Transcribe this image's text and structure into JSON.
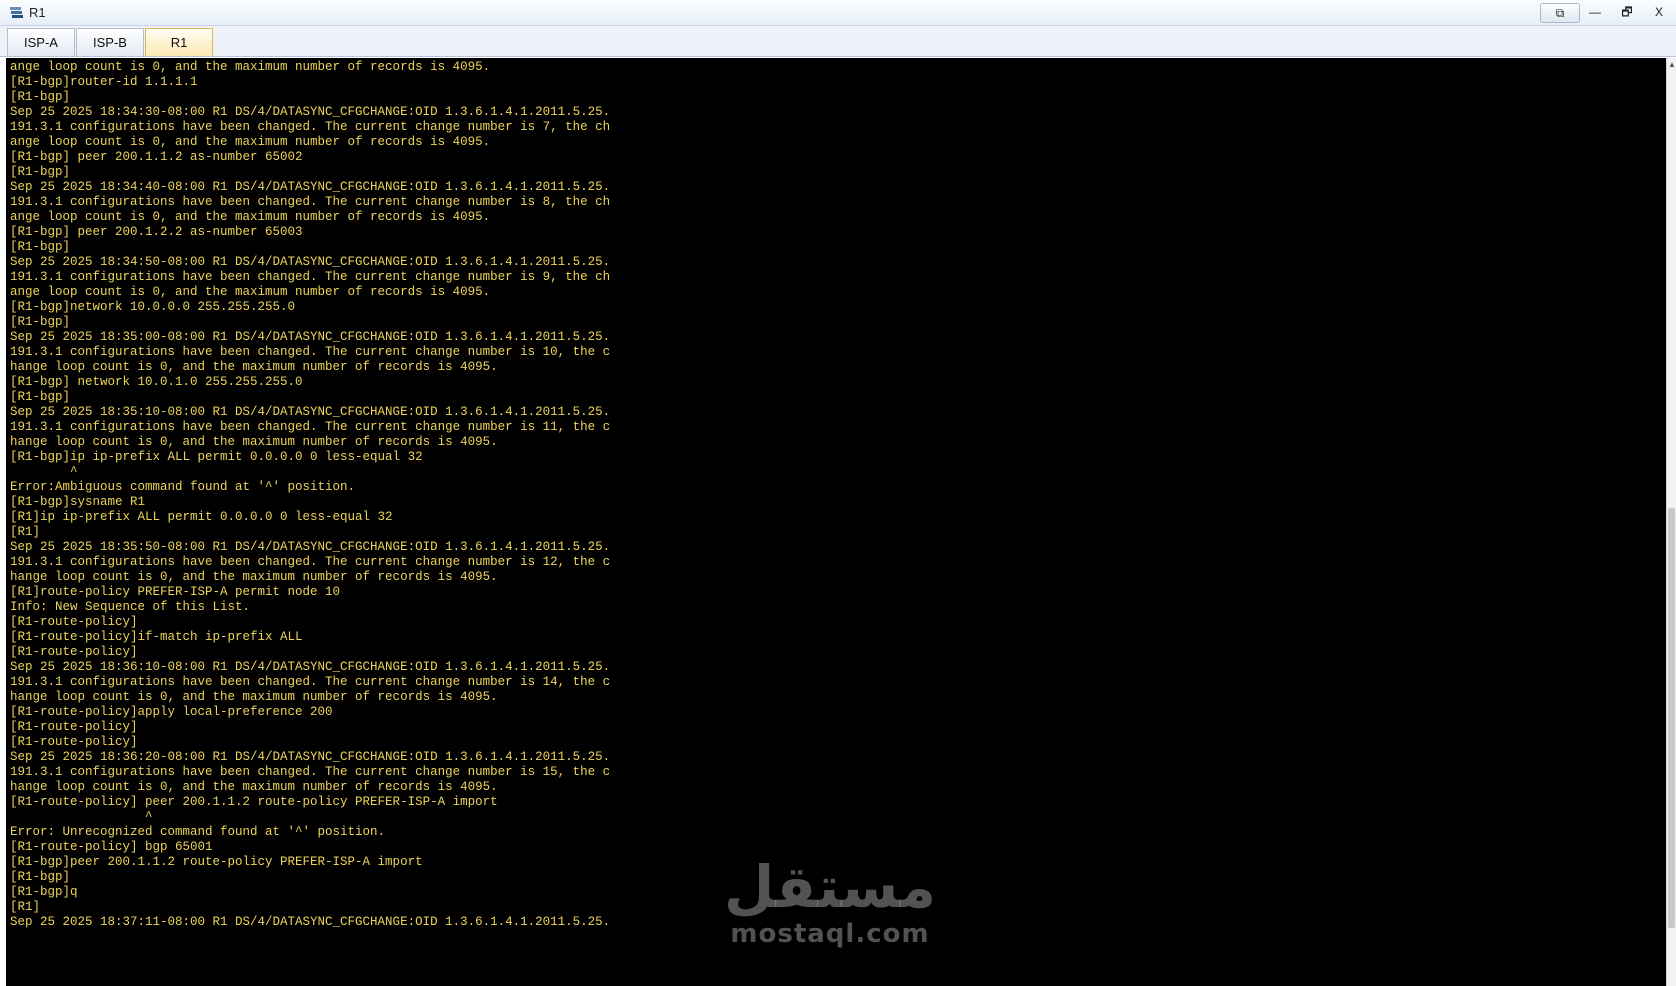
{
  "window": {
    "title": "R1",
    "buttons": {
      "restore_app": "⧉",
      "minimize": "—",
      "maximize": "🗗",
      "close": "X"
    }
  },
  "tabs": [
    {
      "label": "ISP-A",
      "active": false
    },
    {
      "label": "ISP-B",
      "active": false
    },
    {
      "label": "R1",
      "active": true
    }
  ],
  "terminal": {
    "text_color": "#ecd45a",
    "background": "#000000",
    "lines": [
      "ange loop count is 0, and the maximum number of records is 4095.",
      "[R1-bgp]router-id 1.1.1.1",
      "[R1-bgp]",
      "Sep 25 2025 18:34:30-08:00 R1 DS/4/DATASYNC_CFGCHANGE:OID 1.3.6.1.4.1.2011.5.25.",
      "191.3.1 configurations have been changed. The current change number is 7, the ch",
      "ange loop count is 0, and the maximum number of records is 4095.",
      "[R1-bgp] peer 200.1.1.2 as-number 65002",
      "[R1-bgp]",
      "Sep 25 2025 18:34:40-08:00 R1 DS/4/DATASYNC_CFGCHANGE:OID 1.3.6.1.4.1.2011.5.25.",
      "191.3.1 configurations have been changed. The current change number is 8, the ch",
      "ange loop count is 0, and the maximum number of records is 4095.",
      "[R1-bgp] peer 200.1.2.2 as-number 65003",
      "[R1-bgp]",
      "Sep 25 2025 18:34:50-08:00 R1 DS/4/DATASYNC_CFGCHANGE:OID 1.3.6.1.4.1.2011.5.25.",
      "191.3.1 configurations have been changed. The current change number is 9, the ch",
      "ange loop count is 0, and the maximum number of records is 4095.",
      "[R1-bgp]network 10.0.0.0 255.255.255.0",
      "[R1-bgp]",
      "Sep 25 2025 18:35:00-08:00 R1 DS/4/DATASYNC_CFGCHANGE:OID 1.3.6.1.4.1.2011.5.25.",
      "191.3.1 configurations have been changed. The current change number is 10, the c",
      "hange loop count is 0, and the maximum number of records is 4095.",
      "[R1-bgp] network 10.0.1.0 255.255.255.0",
      "[R1-bgp]",
      "Sep 25 2025 18:35:10-08:00 R1 DS/4/DATASYNC_CFGCHANGE:OID 1.3.6.1.4.1.2011.5.25.",
      "191.3.1 configurations have been changed. The current change number is 11, the c",
      "hange loop count is 0, and the maximum number of records is 4095.",
      "[R1-bgp]ip ip-prefix ALL permit 0.0.0.0 0 less-equal 32",
      "        ^",
      "Error:Ambiguous command found at '^' position.",
      "[R1-bgp]sysname R1",
      "[R1]ip ip-prefix ALL permit 0.0.0.0 0 less-equal 32",
      "[R1]",
      "Sep 25 2025 18:35:50-08:00 R1 DS/4/DATASYNC_CFGCHANGE:OID 1.3.6.1.4.1.2011.5.25.",
      "191.3.1 configurations have been changed. The current change number is 12, the c",
      "hange loop count is 0, and the maximum number of records is 4095.",
      "[R1]route-policy PREFER-ISP-A permit node 10",
      "Info: New Sequence of this List.",
      "[R1-route-policy]",
      "[R1-route-policy]if-match ip-prefix ALL",
      "[R1-route-policy]",
      "Sep 25 2025 18:36:10-08:00 R1 DS/4/DATASYNC_CFGCHANGE:OID 1.3.6.1.4.1.2011.5.25.",
      "191.3.1 configurations have been changed. The current change number is 14, the c",
      "hange loop count is 0, and the maximum number of records is 4095.",
      "[R1-route-policy]apply local-preference 200",
      "[R1-route-policy]",
      "[R1-route-policy]",
      "Sep 25 2025 18:36:20-08:00 R1 DS/4/DATASYNC_CFGCHANGE:OID 1.3.6.1.4.1.2011.5.25.",
      "191.3.1 configurations have been changed. The current change number is 15, the c",
      "hange loop count is 0, and the maximum number of records is 4095.",
      "[R1-route-policy] peer 200.1.1.2 route-policy PREFER-ISP-A import",
      "                  ^",
      "Error: Unrecognized command found at '^' position.",
      "[R1-route-policy] bgp 65001",
      "[R1-bgp]peer 200.1.1.2 route-policy PREFER-ISP-A import",
      "[R1-bgp]",
      "[R1-bgp]q",
      "[R1]",
      "Sep 25 2025 18:37:11-08:00 R1 DS/4/DATASYNC_CFGCHANGE:OID 1.3.6.1.4.1.2011.5.25."
    ]
  },
  "watermark": {
    "arabic": "مستقل",
    "latin": "mostaql.com"
  }
}
